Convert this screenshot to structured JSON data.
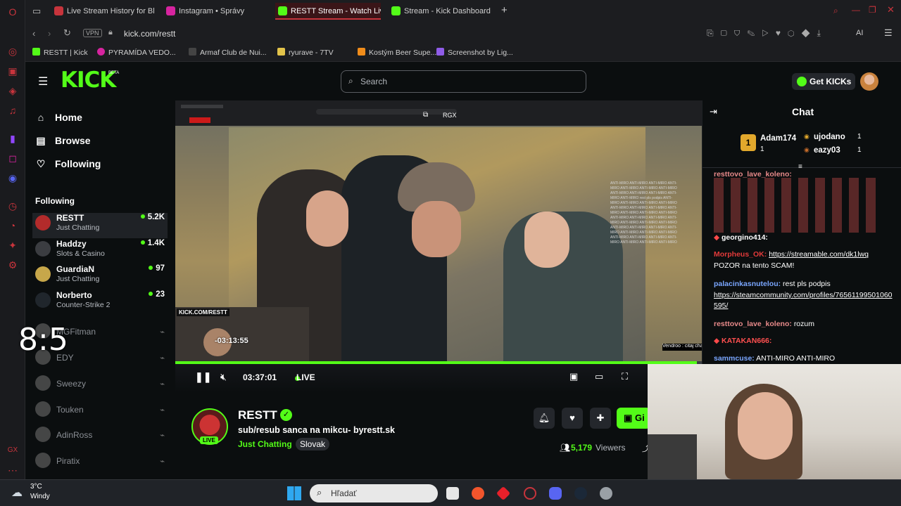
{
  "browser": {
    "tabs": [
      {
        "label": "Live Stream History for Bl",
        "color": "#c7343c"
      },
      {
        "label": "Instagram • Správy",
        "color": "#d6249f"
      },
      {
        "label": "RESTT Stream - Watch Liv",
        "color": "#53fc18"
      },
      {
        "label": "Stream - Kick Dashboard",
        "color": "#53fc18"
      }
    ],
    "new_tab_label": "+",
    "vpn_label": "VPN",
    "url": "kick.com/restt",
    "ai_label": "AI",
    "bookmarks": [
      {
        "label": "RESTT | Kick",
        "color": "#53fc18"
      },
      {
        "label": "PYRAMÍDA VEDO...",
        "color": "#d6249f"
      },
      {
        "label": "Armaf Club de Nui...",
        "color": "#444"
      },
      {
        "label": "ryurave - 7TV",
        "color": "#e2c34a"
      },
      {
        "label": "Kostým Beer Supe...",
        "color": "#f08c1a"
      },
      {
        "label": "Screenshot by Lig...",
        "color": "#8f5ce8"
      }
    ]
  },
  "kick": {
    "logo": "KICK",
    "logo_badge": "BETA",
    "search_placeholder": "Search",
    "get_kicks": "Get KICKs",
    "nav": [
      {
        "label": "Home",
        "icon": "home-icon"
      },
      {
        "label": "Browse",
        "icon": "browse-icon"
      },
      {
        "label": "Following",
        "icon": "heart-icon"
      }
    ],
    "following_title": "Following",
    "following": [
      {
        "name": "RESTT",
        "category": "Just Chatting",
        "viewers": "5.2K",
        "live": true,
        "color": "#b32b2b"
      },
      {
        "name": "Haddzy",
        "category": "Slots & Casino",
        "viewers": "1.4K",
        "live": true,
        "color": "#3b3d41"
      },
      {
        "name": "GuardiaN",
        "category": "Just Chatting",
        "viewers": "97",
        "live": true,
        "color": "#c7a74a"
      },
      {
        "name": "Norberto",
        "category": "Counter-Strike 2",
        "viewers": "23",
        "live": true,
        "color": "#20262c"
      },
      {
        "name": "MGFitman",
        "category": "",
        "viewers": "",
        "live": false,
        "color": "#5a5e64"
      },
      {
        "name": "EDY",
        "category": "",
        "viewers": "",
        "live": false,
        "color": "#5a5e64"
      },
      {
        "name": "Sweezy",
        "category": "",
        "viewers": "",
        "live": false,
        "color": "#5a5e64"
      },
      {
        "name": "Touken",
        "category": "",
        "viewers": "",
        "live": false,
        "color": "#5a5e64"
      },
      {
        "name": "AdinRoss",
        "category": "",
        "viewers": "",
        "live": false,
        "color": "#5a5e64"
      },
      {
        "name": "Piratix",
        "category": "",
        "viewers": "",
        "live": false,
        "color": "#5a5e64"
      }
    ],
    "overlay_timer": "8:5"
  },
  "player": {
    "rgx_label": "RGX",
    "cam_tag": "KICK.COM/RESTT",
    "hover_time": "-03:13:55",
    "time": "03:37:01",
    "live": "LIVE",
    "progress": 0.99,
    "embedded_notice": "Vendroo : citaj chat kokoc"
  },
  "streamer": {
    "name": "RESTT",
    "live_badge": "LIVE",
    "title": "sub/resub sanca na mikcu- byrestt.sk",
    "category": "Just Chatting",
    "tag": "Slovak",
    "viewers": "5,179",
    "viewers_label": "Viewers",
    "sub_button": "Gi"
  },
  "chat": {
    "title": "Chat",
    "leaderboard": [
      {
        "rank": "1",
        "name": "Adam174",
        "count": "1"
      },
      {
        "name": "ujodano",
        "count": "1"
      },
      {
        "name": "eazy03",
        "count": "1"
      }
    ],
    "messages": [
      {
        "user": "resttovo_lave_koleno:",
        "text": "",
        "color": "#e88a8a"
      },
      {
        "user": "georgino414:",
        "text": "",
        "color": "#ffffff"
      },
      {
        "user": "Morpheus_OK:",
        "text": "https://streamable.com/dk1lwq",
        "color": "#e23a3a"
      },
      {
        "user": "",
        "text": "POZOR na tento SCAM!",
        "color": "#fff"
      },
      {
        "user": "palacinkasnutelou:",
        "text": "rest pls podpis",
        "color": "#7aa6ff"
      },
      {
        "user": "",
        "text": "https://steamcommunity.com/profiles/76561199501060595/",
        "color": "#fff"
      },
      {
        "user": "resttovo_lave_koleno:",
        "text": "rozum",
        "color": "#e88a8a"
      },
      {
        "user": "KATAKAN666:",
        "text": "",
        "color": "#ff5050"
      },
      {
        "user": "sammcuse:",
        "text": "ANTI-MIRO   ANTI-MIRO",
        "color": "#7aa6ff"
      }
    ]
  },
  "taskbar": {
    "temp": "3°C",
    "weather": "Windy",
    "search_placeholder": "Hľadať"
  }
}
